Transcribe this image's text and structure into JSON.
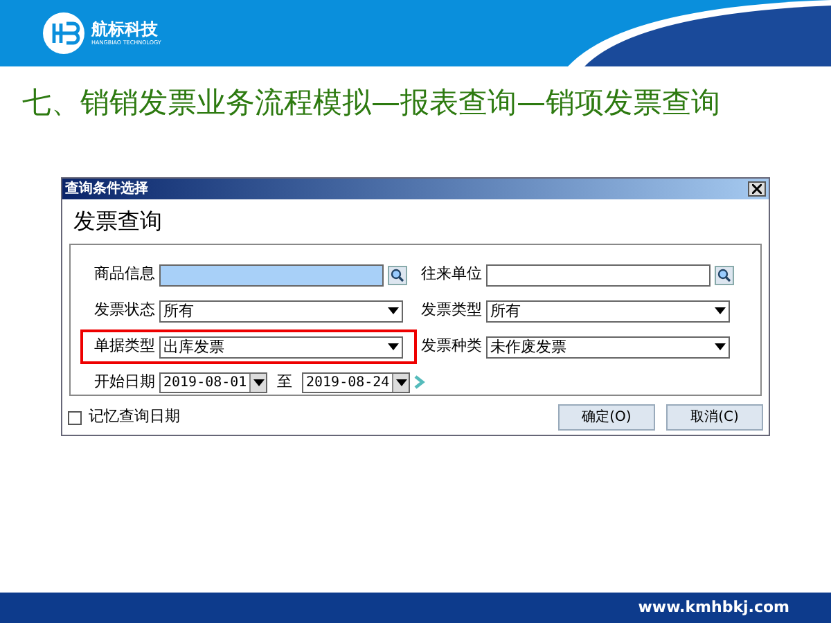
{
  "header": {
    "logo_name": "航标科技",
    "logo_subtitle": "HANGBIAO TECHNOLOGY"
  },
  "slide_title": "七、销销发票业务流程模拟—报表查询—销项发票查询",
  "dialog": {
    "title": "查询条件选择",
    "heading": "发票查询",
    "left_fields": [
      {
        "kind": "search",
        "label": "商品信息",
        "focused": true,
        "highlighted": false
      },
      {
        "kind": "select",
        "label": "发票状态",
        "value": "所有",
        "focused": false,
        "highlighted": false
      },
      {
        "kind": "select",
        "label": "单据类型",
        "value": "出库发票",
        "focused": false,
        "highlighted": true
      }
    ],
    "right_fields": [
      {
        "kind": "search",
        "label": "往来单位",
        "focused": false,
        "highlighted": false
      },
      {
        "kind": "select",
        "label": "发票类型",
        "value": "所有",
        "focused": false,
        "highlighted": false
      },
      {
        "kind": "select",
        "label": "发票种类",
        "value": "未作废发票",
        "focused": false,
        "highlighted": false
      }
    ],
    "date_range": {
      "label": "开始日期",
      "from": "2019-08-01",
      "separator": "至",
      "to": "2019-08-24"
    },
    "remember_dates": {
      "label": "记忆查询日期",
      "checked": false
    },
    "buttons": [
      "确定(O)",
      "取消(C)"
    ]
  },
  "footer": {
    "url": "www.kmhbkj.com"
  }
}
